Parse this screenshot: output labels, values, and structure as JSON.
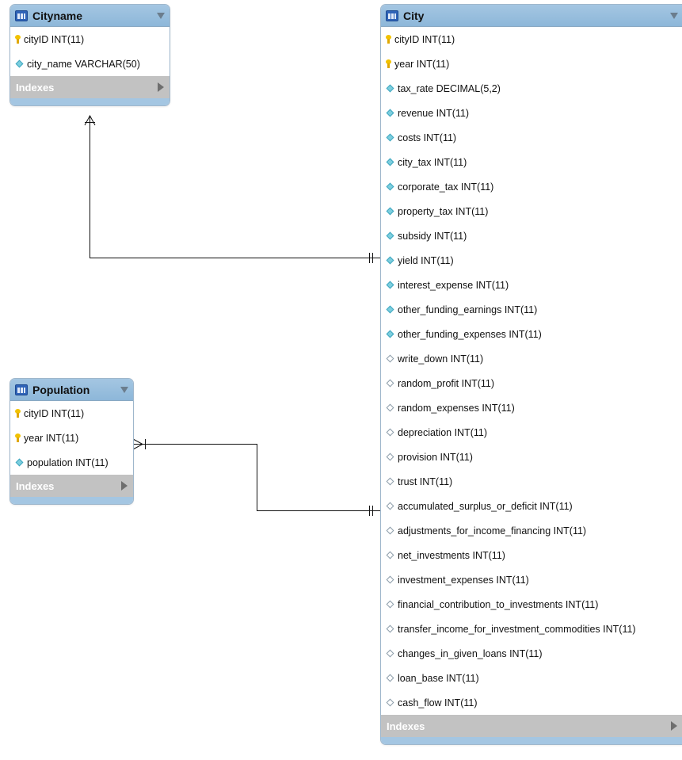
{
  "tables": {
    "cityname": {
      "title": "Cityname",
      "indexes_label": "Indexes",
      "columns": [
        {
          "text": "cityID INT(11)",
          "kind": "key"
        },
        {
          "text": "city_name VARCHAR(50)",
          "kind": "filled"
        }
      ]
    },
    "population": {
      "title": "Population",
      "indexes_label": "Indexes",
      "columns": [
        {
          "text": "cityID INT(11)",
          "kind": "key"
        },
        {
          "text": "year INT(11)",
          "kind": "key"
        },
        {
          "text": "population INT(11)",
          "kind": "filled"
        }
      ]
    },
    "city": {
      "title": "City",
      "indexes_label": "Indexes",
      "columns": [
        {
          "text": "cityID INT(11)",
          "kind": "key"
        },
        {
          "text": "year INT(11)",
          "kind": "key"
        },
        {
          "text": "tax_rate DECIMAL(5,2)",
          "kind": "filled"
        },
        {
          "text": "revenue INT(11)",
          "kind": "filled"
        },
        {
          "text": "costs INT(11)",
          "kind": "filled"
        },
        {
          "text": "city_tax INT(11)",
          "kind": "filled"
        },
        {
          "text": "corporate_tax INT(11)",
          "kind": "filled"
        },
        {
          "text": "property_tax INT(11)",
          "kind": "filled"
        },
        {
          "text": "subsidy INT(11)",
          "kind": "filled"
        },
        {
          "text": "yield INT(11)",
          "kind": "filled"
        },
        {
          "text": "interest_expense INT(11)",
          "kind": "filled"
        },
        {
          "text": "other_funding_earnings INT(11)",
          "kind": "filled"
        },
        {
          "text": "other_funding_expenses INT(11)",
          "kind": "filled"
        },
        {
          "text": "write_down INT(11)",
          "kind": "hollow"
        },
        {
          "text": "random_profit INT(11)",
          "kind": "hollow"
        },
        {
          "text": "random_expenses INT(11)",
          "kind": "hollow"
        },
        {
          "text": "depreciation INT(11)",
          "kind": "hollow"
        },
        {
          "text": "provision INT(11)",
          "kind": "hollow"
        },
        {
          "text": "trust INT(11)",
          "kind": "hollow"
        },
        {
          "text": "accumulated_surplus_or_deficit INT(11)",
          "kind": "hollow"
        },
        {
          "text": "adjustments_for_income_financing INT(11)",
          "kind": "hollow"
        },
        {
          "text": "net_investments INT(11)",
          "kind": "hollow"
        },
        {
          "text": "investment_expenses INT(11)",
          "kind": "hollow"
        },
        {
          "text": "financial_contribution_to_investments INT(11)",
          "kind": "hollow"
        },
        {
          "text": "transfer_income_for_investment_commodities INT(11)",
          "kind": "hollow"
        },
        {
          "text": "changes_in_given_loans INT(11)",
          "kind": "hollow"
        },
        {
          "text": "loan_base INT(11)",
          "kind": "hollow"
        },
        {
          "text": "cash_flow INT(11)",
          "kind": "hollow"
        }
      ]
    }
  },
  "relationships": [
    {
      "from": "cityname",
      "to": "city",
      "from_end": "many",
      "to_end": "one"
    },
    {
      "from": "population",
      "to": "city",
      "from_end": "many",
      "to_end": "one"
    }
  ]
}
